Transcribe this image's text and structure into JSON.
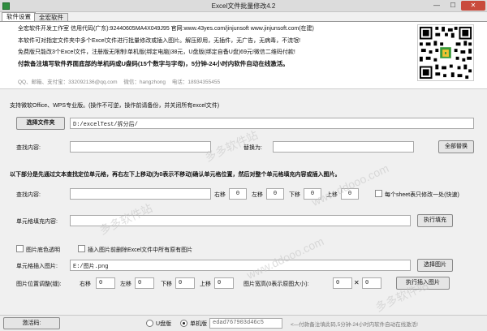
{
  "window": {
    "title": "Excel文件批量修改4.2",
    "min": "—",
    "max": "☐",
    "close": "✕"
  },
  "tabs": [
    {
      "label": "软件设置",
      "active": true
    },
    {
      "label": "全宏软件",
      "active": false
    }
  ],
  "header": {
    "company": "全宏软件开发工作室  信用代码(广东):92440605MA4X049J95  官网:www.43yes.com/jinjunsoft  www.jinjunsoft.com(在建)",
    "desc1": "本软件可对指定文件夹中多个Excel文件进行批量修改或插入图片。解压即用，无插件，无广告，无病毒，不流氓!",
    "desc2": "免费版只能改3个Excel文件，注册版无限制!单机版(绑定电脑)38元，U盘版(绑定自备U盘)69元!微信二维码付款!",
    "note": "付款备注填写软件界面底部的单机码或U盘码(15个数字与字母)，5分钟-24小时内软件自动在线激活。",
    "contact": "QQ、邮箱、支付宝：332092136@qq.com    微信：hangzhong    电话：18934355455"
  },
  "form": {
    "support_note": "支持微软Office、WPS专业版。(操作不可逆，操作前请备份，并关闭所有excel文件)",
    "select_folder_button": "选择文件夹",
    "folder_path": "D:/excelTest/拆分后/",
    "find_label": "查找内容:",
    "find_value": "",
    "replace_label": "替换为:",
    "replace_value": "",
    "replace_all_button": "全部替换",
    "instruction": "以下部分是先通过文本查找定位单元格，再右左下上移动(为0表示不移动)确认单元格位置，然后对整个单元格填充内容或插入图片。",
    "find2_label": "查找内容:",
    "find2_value": "",
    "move_right_label": "右移",
    "move_right_value": "0",
    "move_left_label": "左移",
    "move_left_value": "0",
    "move_down_label": "下移",
    "move_down_value": "0",
    "move_up_label": "上移",
    "move_up_value": "0",
    "each_sheet_label": "每个sheet表只修改一处(快速)",
    "fill_label": "单元格填充内容:",
    "fill_value": "",
    "fill_button": "执行填充",
    "transparent_label": "图片底色透明",
    "delete_images_label": "插入图片前删除Excel文件中所有原有图片",
    "insert_image_label": "单元格插入图片:",
    "image_path": "E:/图片.png",
    "select_image_button": "选择图片",
    "pos_adjust_label": "图片位置调整(缝):",
    "pos_right_label": "右移",
    "pos_right_value": "0",
    "pos_left_label": "左移",
    "pos_left_value": "0",
    "pos_down_label": "下移",
    "pos_down_value": "0",
    "pos_up_label": "上移",
    "pos_up_value": "0",
    "img_size_label": "图片宽高(0表示原图大小):",
    "img_width_value": "0",
    "img_times": "✕",
    "img_height_value": "0",
    "insert_image_button": "执行插入图片"
  },
  "status": {
    "activate_button": "激活码:",
    "usb_label": "U盘版",
    "standalone_label": "单机版",
    "machine_code": "edad767903d46c5",
    "activation_hint": "<—付款备注填此码,5分钟-24小时内软件自动在线激活!"
  },
  "watermarks": [
    "多多软件站",
    "www.ddooo.com",
    "多多软件站",
    "www.ddooo.com",
    "多多软件站"
  ]
}
